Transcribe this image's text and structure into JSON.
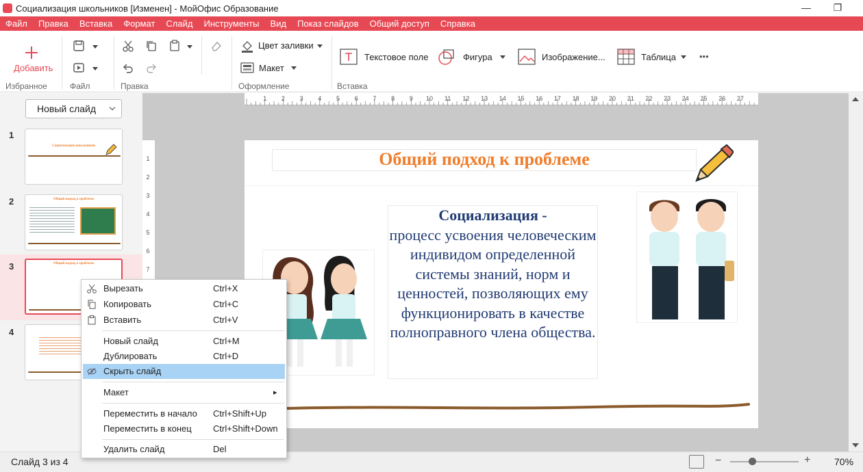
{
  "window": {
    "title": "Социализация школьников [Изменен] - МойОфис Образование",
    "minimize": "—",
    "maximize": "❐"
  },
  "menu": [
    "Файл",
    "Правка",
    "Вставка",
    "Формат",
    "Слайд",
    "Инструменты",
    "Вид",
    "Показ слайдов",
    "Общий доступ",
    "Справка"
  ],
  "ribbon": {
    "add_label": "Добавить",
    "groups": {
      "favorites": "Избранное",
      "file": "Файл",
      "edit": "Правка",
      "design": "Оформление",
      "insert": "Вставка"
    },
    "fill_color": "Цвет заливки",
    "layout": "Макет",
    "text_field": "Текстовое поле",
    "shape": "Фигура",
    "image": "Изображение...",
    "table": "Таблица",
    "more": "•••"
  },
  "panel": {
    "new_slide": "Новый слайд",
    "slides": [
      {
        "num": "1",
        "title": "Социализация школьников"
      },
      {
        "num": "2",
        "title": "Общий подход к проблеме"
      },
      {
        "num": "3",
        "title": "Общий подход к проблеме"
      },
      {
        "num": "4",
        "title": ""
      }
    ]
  },
  "ruler": {
    "h": [
      "1",
      "2",
      "3",
      "4",
      "5",
      "6",
      "7",
      "8",
      "9",
      "10",
      "11",
      "12",
      "13",
      "14",
      "15",
      "16",
      "17",
      "18",
      "19",
      "20",
      "21",
      "22",
      "23",
      "24",
      "25",
      "26",
      "27"
    ],
    "v": [
      "1",
      "2",
      "3",
      "4",
      "5",
      "6",
      "7"
    ]
  },
  "slide": {
    "title": "Общий подход к проблеме",
    "term": "Социализация",
    "dash": " -",
    "body": "процесс усвоения человеческим индивидом определенной системы знаний, норм и ценностей, позволяющих ему функционировать в качестве полноправного члена общества."
  },
  "context_menu": [
    {
      "label": "Вырезать",
      "shortcut": "Ctrl+X",
      "icon": "scissors-icon"
    },
    {
      "label": "Копировать",
      "shortcut": "Ctrl+C",
      "icon": "copy-icon"
    },
    {
      "label": "Вставить",
      "shortcut": "Ctrl+V",
      "icon": "paste-icon"
    },
    {
      "label": "Новый слайд",
      "shortcut": "Ctrl+M"
    },
    {
      "label": "Дублировать",
      "shortcut": "Ctrl+D"
    },
    {
      "label": "Скрыть слайд",
      "shortcut": "",
      "icon": "hide-icon"
    },
    {
      "label": "Макет",
      "shortcut": "▸"
    },
    {
      "label": "Переместить в начало",
      "shortcut": "Ctrl+Shift+Up"
    },
    {
      "label": "Переместить в конец",
      "shortcut": "Ctrl+Shift+Down"
    },
    {
      "label": "Удалить слайд",
      "shortcut": "Del"
    }
  ],
  "status": {
    "slide_counter": "Слайд 3 из 4",
    "zoom": "70%",
    "zoom_level": 0.7,
    "minus": "−",
    "plus": "+"
  },
  "colors": {
    "accent": "#e74954",
    "title_orange": "#f07d2b",
    "body_blue": "#203a72",
    "highlight": "#a9d3f5"
  }
}
